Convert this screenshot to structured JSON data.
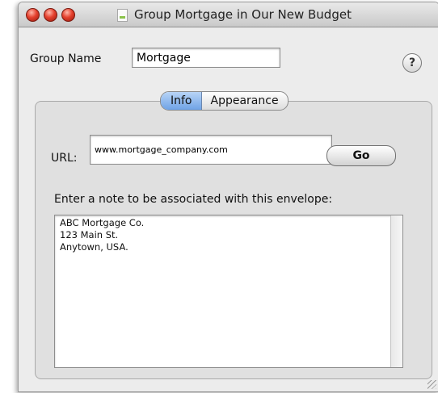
{
  "window": {
    "title": "Group Mortgage in Our New Budget"
  },
  "group_name": {
    "label": "Group Name",
    "value": "Mortgage"
  },
  "help": {
    "glyph": "?"
  },
  "tabs": [
    {
      "label": "Info",
      "selected": true
    },
    {
      "label": "Appearance",
      "selected": false
    }
  ],
  "url": {
    "label": "URL:",
    "value": "www.mortgage_company.com"
  },
  "go_button": {
    "label": "Go"
  },
  "note": {
    "label": "Enter a note to be associated with this envelope:",
    "lines": [
      "ABC Mortgage Co.",
      "123 Main St.",
      "Anytown, USA."
    ]
  }
}
